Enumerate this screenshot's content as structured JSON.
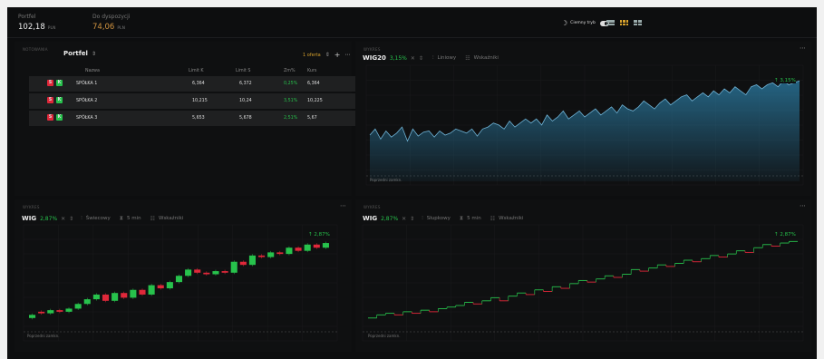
{
  "header": {
    "portfolio_label": "Portfel",
    "portfolio_value": "102,18",
    "portfolio_currency": "PLN",
    "available_label": "Do dyspozycji",
    "available_value": "74,06",
    "available_currency": "PLN",
    "darkmode_label": "Ciemny tryb"
  },
  "portfolio_panel": {
    "small_title": "NOTOWANIA",
    "title": "Portfel",
    "count_label": "1 oferta",
    "columns": [
      "Nazwa",
      "Limit K",
      "Limit S",
      "Zm%",
      "Kurs"
    ],
    "rows": [
      {
        "name": "SPÓŁKA 1",
        "limit_k": "6,364",
        "limit_s": "6,372",
        "change": "0,25%",
        "price": "6,364"
      },
      {
        "name": "SPÓŁKA 2",
        "limit_k": "10,215",
        "limit_s": "10,24",
        "change": "3,51%",
        "price": "10,225"
      },
      {
        "name": "SPÓŁKA 3",
        "limit_k": "5,653",
        "limit_s": "5,678",
        "change": "2,51%",
        "price": "5,67"
      }
    ]
  },
  "chart_wig20": {
    "small_title": "WYKRES",
    "name": "WIG20",
    "change": "3,15%",
    "type_label": "Liniowy",
    "indicators_label": "Wskaźniki",
    "badge": "3,15%",
    "source": "Poprzedni zamkn."
  },
  "chart_wig_candle": {
    "small_title": "WYKRES",
    "name": "WIG",
    "change": "2,87%",
    "type_label": "Świecowy",
    "interval_label": "5 min",
    "indicators_label": "Wskaźniki",
    "badge": "2,87%",
    "source": "Poprzedni zamkn."
  },
  "chart_wig_step": {
    "small_title": "WYKRES",
    "name": "WIG",
    "change": "2,87%",
    "type_label": "Słupkowy",
    "interval_label": "5 min",
    "indicators_label": "Wskaźniki",
    "badge": "2,87%",
    "source": "Poprzedni zamkn."
  },
  "colors": {
    "up": "#27c24c",
    "down": "#e0283a",
    "area": "#2c7fa8",
    "bg": "#0d0e0f"
  },
  "chart_data": [
    {
      "type": "area",
      "series": [
        {
          "name": "WIG20",
          "values": [
            46,
            52,
            42,
            50,
            44,
            48,
            54,
            40,
            52,
            45,
            49,
            50,
            44,
            50,
            46,
            48,
            52,
            50,
            48,
            52,
            45,
            52,
            54,
            58,
            56,
            52,
            60,
            54,
            58,
            62,
            58,
            62,
            56,
            66,
            60,
            64,
            70,
            62,
            66,
            70,
            64,
            68,
            72,
            66,
            70,
            74,
            68,
            76,
            72,
            70,
            74,
            80,
            76,
            72,
            78,
            82,
            76,
            80,
            84,
            86,
            80,
            84,
            88,
            84,
            90,
            86,
            92,
            88,
            94,
            90,
            86,
            94,
            96,
            92,
            96,
            98,
            94,
            100,
            96,
            98,
            100
          ]
        }
      ],
      "ylim": [
        0,
        110
      ]
    },
    {
      "type": "bar",
      "series": [
        {
          "name": "WIG",
          "candles": [
            [
              10,
              12
            ],
            [
              14,
              13
            ],
            [
              13,
              15
            ],
            [
              15,
              14
            ],
            [
              14,
              16
            ],
            [
              16,
              19
            ],
            [
              19,
              22
            ],
            [
              22,
              25
            ],
            [
              25,
              21
            ],
            [
              21,
              26
            ],
            [
              26,
              23
            ],
            [
              23,
              28
            ],
            [
              28,
              25
            ],
            [
              25,
              31
            ],
            [
              31,
              29
            ],
            [
              29,
              33
            ],
            [
              33,
              37
            ],
            [
              37,
              41
            ],
            [
              41,
              39
            ],
            [
              39,
              38
            ],
            [
              38,
              40
            ],
            [
              40,
              39
            ],
            [
              39,
              46
            ],
            [
              46,
              44
            ],
            [
              44,
              50
            ],
            [
              50,
              49
            ],
            [
              49,
              52
            ],
            [
              52,
              51
            ],
            [
              51,
              55
            ],
            [
              55,
              53
            ],
            [
              53,
              57
            ],
            [
              57,
              55
            ],
            [
              55,
              58
            ]
          ]
        }
      ],
      "ylim": [
        0,
        65
      ]
    },
    {
      "type": "line",
      "series": [
        {
          "name": "WIG",
          "steps": [
            10,
            12,
            13,
            12,
            14,
            13,
            15,
            14,
            16,
            17,
            18,
            20,
            19,
            21,
            23,
            21,
            24,
            26,
            25,
            28,
            27,
            30,
            29,
            32,
            34,
            33,
            35,
            37,
            36,
            38,
            41,
            40,
            42,
            44,
            43,
            45,
            47,
            46,
            48,
            50,
            49,
            51,
            53,
            52,
            55,
            57,
            56,
            58,
            59
          ]
        }
      ],
      "ylim": [
        0,
        65
      ]
    }
  ]
}
